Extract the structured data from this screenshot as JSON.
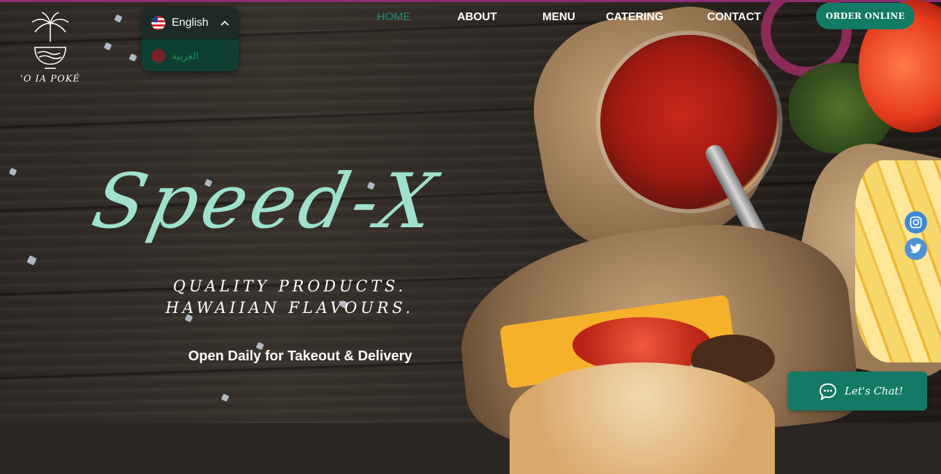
{
  "logo": {
    "text": "'O IA POKÉ",
    "icon": "palm-bowl-icon"
  },
  "language": {
    "current": "English",
    "options": [
      "العربية"
    ],
    "current_flag": "us-flag-icon",
    "option_flag": "arabic-flag-icon"
  },
  "nav": {
    "items": [
      "HOME",
      "ABOUT",
      "MENU",
      "CATERING",
      "CONTACT"
    ],
    "active": "HOME",
    "order_button": "ORDER ONLINE"
  },
  "hero": {
    "title": "Speed-X",
    "subtitle": "QUALITY PRODUCTS. HAWAIIAN FLAVOURS.",
    "open_text": "Open Daily for Takeout & Delivery"
  },
  "social": [
    "instagram-icon",
    "twitter-icon"
  ],
  "chat": {
    "label": "Let's Chat!"
  },
  "colors": {
    "accent": "#137a65",
    "title": "#9fe1cc",
    "active_nav": "#1d8a72",
    "social": "#3e89d6",
    "topline": "#8d2d77"
  }
}
